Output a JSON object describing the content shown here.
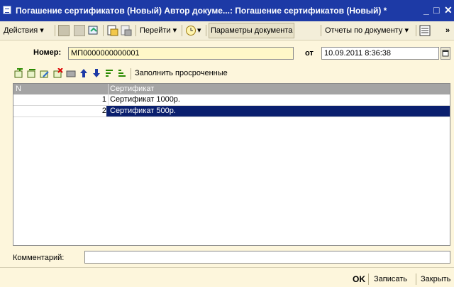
{
  "window": {
    "title": "Погашение сертификатов (Новый)  Автор докуме...: Погашение сертификатов (Новый) *",
    "minimize_glyph": "_",
    "maximize_glyph": "□",
    "close_glyph": "✕"
  },
  "toolbar": {
    "actions_label": "Действия ▾",
    "goto_label": "Перейти ▾",
    "params_label": "Параметры документа",
    "reports_label": "Отчеты по документу ▾",
    "more_glyph": "»"
  },
  "header": {
    "number_label": "Номер:",
    "number_value": "МП0000000000001",
    "date_label": "от",
    "date_value": "10.09.2011  8:36:38"
  },
  "grid_toolbar": {
    "fill_overdue_label": "Заполнить просроченные"
  },
  "table": {
    "columns": [
      "N",
      "Сертификат"
    ],
    "rows": [
      {
        "n": "1",
        "certificate": "Сертификат 1000р."
      },
      {
        "n": "2",
        "certificate": "Сертификат 500р."
      }
    ],
    "selected_row": 2
  },
  "comment": {
    "label": "Комментарий:",
    "value": ""
  },
  "buttons": {
    "ok": "OK",
    "save": "Записать",
    "close": "Закрыть"
  },
  "colors": {
    "titlebar": "#1d3aa6",
    "form_bg": "#fdf6dc",
    "selection": "#0a1f6e",
    "grid_header": "#a4a4a4"
  }
}
